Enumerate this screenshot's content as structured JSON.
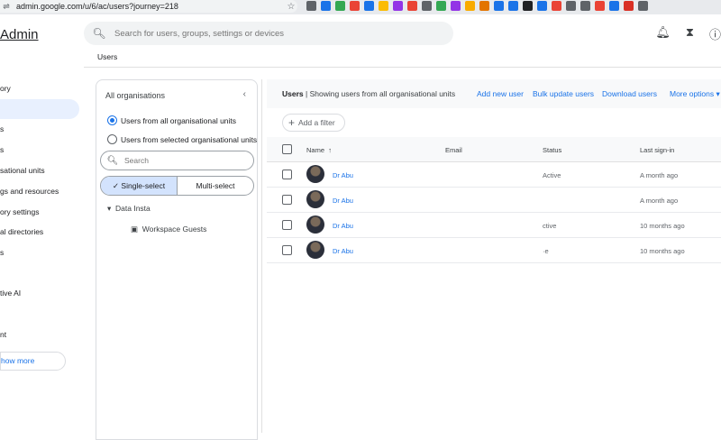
{
  "browser": {
    "url": "admin.google.com/u/6/ac/users?journey=218",
    "extensions": [
      {
        "icon": "ext-icon",
        "color": "#5f6368"
      },
      {
        "icon": "ext-icon",
        "color": "#1a73e8"
      },
      {
        "icon": "ext-icon",
        "color": "#34a853"
      },
      {
        "icon": "ext-icon",
        "color": "#ea4335"
      },
      {
        "icon": "ext-icon",
        "color": "#1a73e8"
      },
      {
        "icon": "ext-icon",
        "color": "#fbbc04"
      },
      {
        "icon": "ext-icon",
        "color": "#9334e6"
      },
      {
        "icon": "ext-icon",
        "color": "#ea4335"
      },
      {
        "icon": "ext-icon",
        "color": "#5f6368"
      },
      {
        "icon": "ext-icon",
        "color": "#34a853"
      },
      {
        "icon": "ext-icon",
        "color": "#9334e6"
      },
      {
        "icon": "ext-icon",
        "color": "#f9ab00"
      },
      {
        "icon": "ext-icon",
        "color": "#e37400"
      },
      {
        "icon": "ext-icon",
        "color": "#1a73e8"
      },
      {
        "icon": "ext-icon",
        "color": "#1a73e8"
      },
      {
        "icon": "ext-icon",
        "color": "#202124"
      },
      {
        "icon": "ext-icon",
        "color": "#1a73e8"
      },
      {
        "icon": "ext-icon",
        "color": "#ea4335"
      },
      {
        "icon": "ext-icon",
        "color": "#5f6368"
      },
      {
        "icon": "ext-icon",
        "color": "#5f6368"
      },
      {
        "icon": "ext-icon",
        "color": "#ea4335"
      },
      {
        "icon": "ext-icon",
        "color": "#1a73e8"
      },
      {
        "icon": "ext-icon",
        "color": "#d93025"
      },
      {
        "icon": "ext-icon",
        "color": "#5f6368"
      }
    ]
  },
  "header": {
    "brand": "Admin",
    "search_placeholder": "Search for users, groups, settings or devices"
  },
  "breadcrumb": "Users",
  "left_nav": {
    "items": [
      "ory",
      "s",
      "s",
      "sational units",
      "gs and resources",
      "ory settings",
      "al directories",
      "s",
      "tive AI",
      "nt"
    ],
    "show_more": "how more"
  },
  "org_panel": {
    "title": "All organisations",
    "radio_all": "Users from all organisational units",
    "radio_selected": "Users from selected organisational units",
    "search_placeholder": "Search",
    "single_select": "Single-select",
    "multi_select": "Multi-select",
    "tree_root": "Data Insta",
    "tree_child": "Workspace Guests"
  },
  "main": {
    "title_bold": "Users",
    "title_rest": " | Showing users from all organisational units",
    "add_new_user": "Add new user",
    "bulk_update": "Bulk update users",
    "download": "Download users",
    "more_options": "More options",
    "add_filter": "Add a filter",
    "columns": {
      "name": "Name",
      "email": "Email",
      "status": "Status",
      "last_signin": "Last sign-in"
    },
    "rows": [
      {
        "name": "Dr Abu",
        "status": "Active",
        "last": "A month ago"
      },
      {
        "name": "Dr Abu",
        "status": "",
        "last": "A month ago"
      },
      {
        "name": "Dr Abu",
        "status": "ctive",
        "last": "10 months ago"
      },
      {
        "name": "Dr Abu",
        "status": "·e",
        "last": "10 months ago"
      }
    ]
  }
}
